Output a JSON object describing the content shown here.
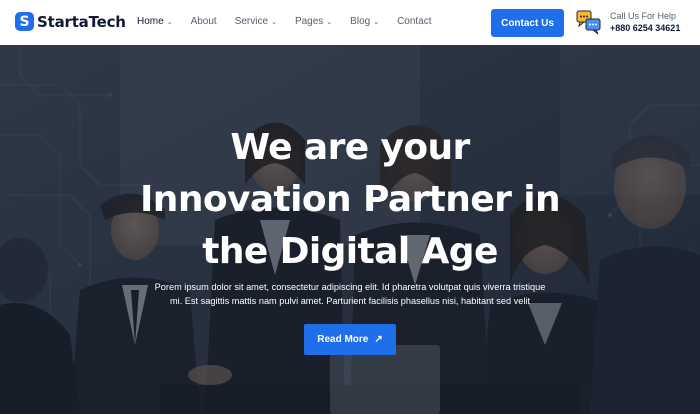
{
  "brand": {
    "name": "StartaTech",
    "mark": "S"
  },
  "nav": {
    "items": [
      {
        "label": "Home",
        "has_dropdown": true,
        "active": true
      },
      {
        "label": "About",
        "has_dropdown": false,
        "active": false
      },
      {
        "label": "Service",
        "has_dropdown": true,
        "active": false
      },
      {
        "label": "Pages",
        "has_dropdown": true,
        "active": false
      },
      {
        "label": "Blog",
        "has_dropdown": true,
        "active": false
      },
      {
        "label": "Contact",
        "has_dropdown": false,
        "active": false
      }
    ]
  },
  "header": {
    "cta_label": "Contact Us",
    "help_label": "Call Us For Help",
    "help_phone": "+880 6254 34621",
    "help_icon": "chat-bubbles-icon"
  },
  "hero": {
    "title_lines": [
      "We are your",
      "Innovation Partner in",
      "the Digital Age"
    ],
    "description_lines": [
      "Porem ipsum dolor sit amet, consectetur adipiscing elit. Id pharetra volutpat quis viverra tristique",
      "mi. Est sagittis mattis nam pulvi amet. Parturient facilisis phasellus nisi, habitant sed velit"
    ],
    "button_label": "Read More",
    "button_icon": "arrow-up-right-icon"
  },
  "colors": {
    "primary": "#1f6feb",
    "heading": "#0f1b33",
    "nav_text": "#55606e",
    "hero_text": "#ffffff"
  }
}
